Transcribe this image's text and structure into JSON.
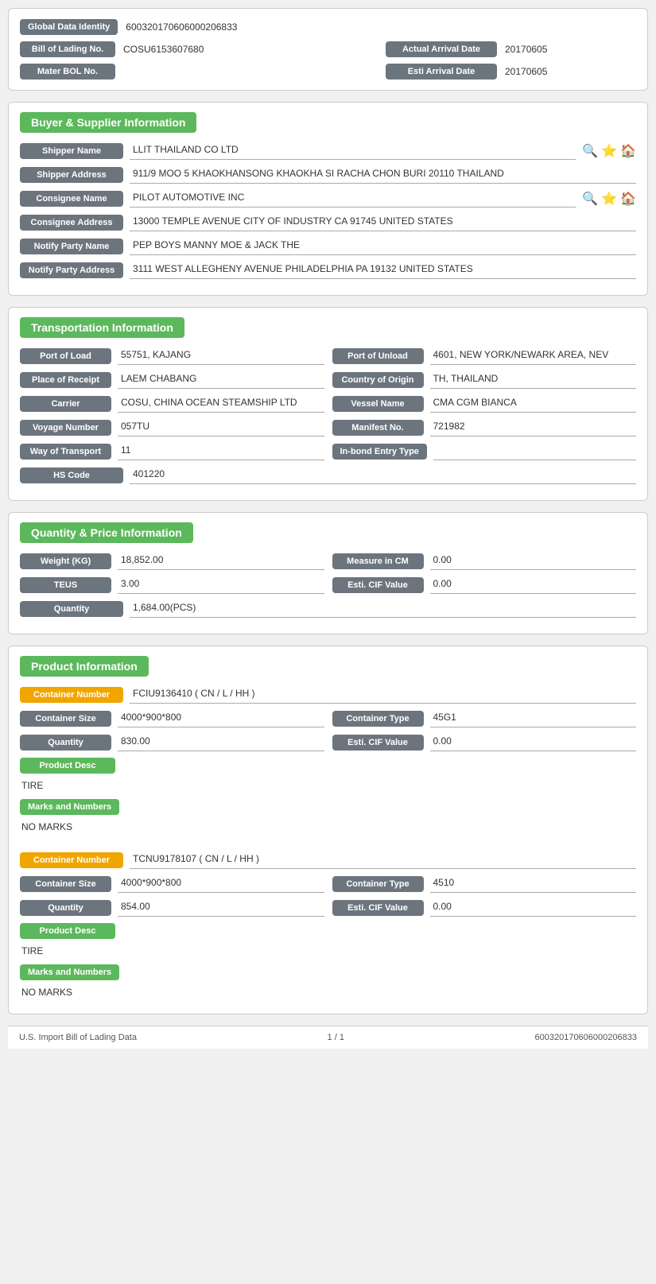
{
  "header": {
    "global_data_label": "Global Data Identity",
    "global_data_value": "600320170606000206833",
    "bill_of_lading_label": "Bill of Lading No.",
    "bill_of_lading_value": "COSU6153607680",
    "actual_arrival_label": "Actual Arrival Date",
    "actual_arrival_value": "20170605",
    "mater_bol_label": "Mater BOL No.",
    "esti_arrival_label": "Esti Arrival Date",
    "esti_arrival_value": "20170605"
  },
  "buyer_supplier": {
    "section_title": "Buyer & Supplier Information",
    "shipper_name_label": "Shipper Name",
    "shipper_name_value": "LLIT THAILAND CO LTD",
    "shipper_address_label": "Shipper Address",
    "shipper_address_value": "911/9 MOO 5 KHAOKHANSONG KHAOKHA SI RACHA CHON BURI 20110 THAILAND",
    "consignee_name_label": "Consignee Name",
    "consignee_name_value": "PILOT AUTOMOTIVE INC",
    "consignee_address_label": "Consignee Address",
    "consignee_address_value": "13000 TEMPLE AVENUE CITY OF INDUSTRY CA 91745 UNITED STATES",
    "notify_party_name_label": "Notify Party Name",
    "notify_party_name_value": "PEP BOYS MANNY MOE & JACK THE",
    "notify_party_address_label": "Notify Party Address",
    "notify_party_address_value": "3111 WEST ALLEGHENY AVENUE PHILADELPHIA PA 19132 UNITED STATES"
  },
  "transportation": {
    "section_title": "Transportation Information",
    "port_of_load_label": "Port of Load",
    "port_of_load_value": "55751, KAJANG",
    "port_of_unload_label": "Port of Unload",
    "port_of_unload_value": "4601, NEW YORK/NEWARK AREA, NEV",
    "place_of_receipt_label": "Place of Receipt",
    "place_of_receipt_value": "LAEM CHABANG",
    "country_of_origin_label": "Country of Origin",
    "country_of_origin_value": "TH, THAILAND",
    "carrier_label": "Carrier",
    "carrier_value": "COSU, CHINA OCEAN STEAMSHIP LTD",
    "vessel_name_label": "Vessel Name",
    "vessel_name_value": "CMA CGM BIANCA",
    "voyage_number_label": "Voyage Number",
    "voyage_number_value": "057TU",
    "manifest_no_label": "Manifest No.",
    "manifest_no_value": "721982",
    "way_of_transport_label": "Way of Transport",
    "way_of_transport_value": "11",
    "inbond_entry_label": "In-bond Entry Type",
    "inbond_entry_value": "",
    "hs_code_label": "HS Code",
    "hs_code_value": "401220"
  },
  "quantity_price": {
    "section_title": "Quantity & Price Information",
    "weight_label": "Weight (KG)",
    "weight_value": "18,852.00",
    "measure_label": "Measure in CM",
    "measure_value": "0.00",
    "teus_label": "TEUS",
    "teus_value": "3.00",
    "esti_cif_label": "Esti. CIF Value",
    "esti_cif_value": "0.00",
    "quantity_label": "Quantity",
    "quantity_value": "1,684.00(PCS)"
  },
  "product_info": {
    "section_title": "Product Information",
    "containers": [
      {
        "container_number_label": "Container Number",
        "container_number_value": "FCIU9136410 ( CN / L / HH )",
        "container_size_label": "Container Size",
        "container_size_value": "4000*900*800",
        "container_type_label": "Container Type",
        "container_type_value": "45G1",
        "quantity_label": "Quantity",
        "quantity_value": "830.00",
        "esti_cif_label": "Esti. CIF Value",
        "esti_cif_value": "0.00",
        "product_desc_label": "Product Desc",
        "product_desc_value": "TIRE",
        "marks_and_numbers_label": "Marks and Numbers",
        "marks_and_numbers_value": "NO MARKS"
      },
      {
        "container_number_label": "Container Number",
        "container_number_value": "TCNU9178107 ( CN / L / HH )",
        "container_size_label": "Container Size",
        "container_size_value": "4000*900*800",
        "container_type_label": "Container Type",
        "container_type_value": "4510",
        "quantity_label": "Quantity",
        "quantity_value": "854.00",
        "esti_cif_label": "Esti. CIF Value",
        "esti_cif_value": "0.00",
        "product_desc_label": "Product Desc",
        "product_desc_value": "TIRE",
        "marks_and_numbers_label": "Marks and Numbers",
        "marks_and_numbers_value": "NO MARKS"
      }
    ]
  },
  "footer": {
    "left": "U.S. Import Bill of Lading Data",
    "center": "1 / 1",
    "right": "600320170606000206833"
  },
  "icons": {
    "search": "🔍",
    "star": "⭐",
    "home": "🏠"
  }
}
